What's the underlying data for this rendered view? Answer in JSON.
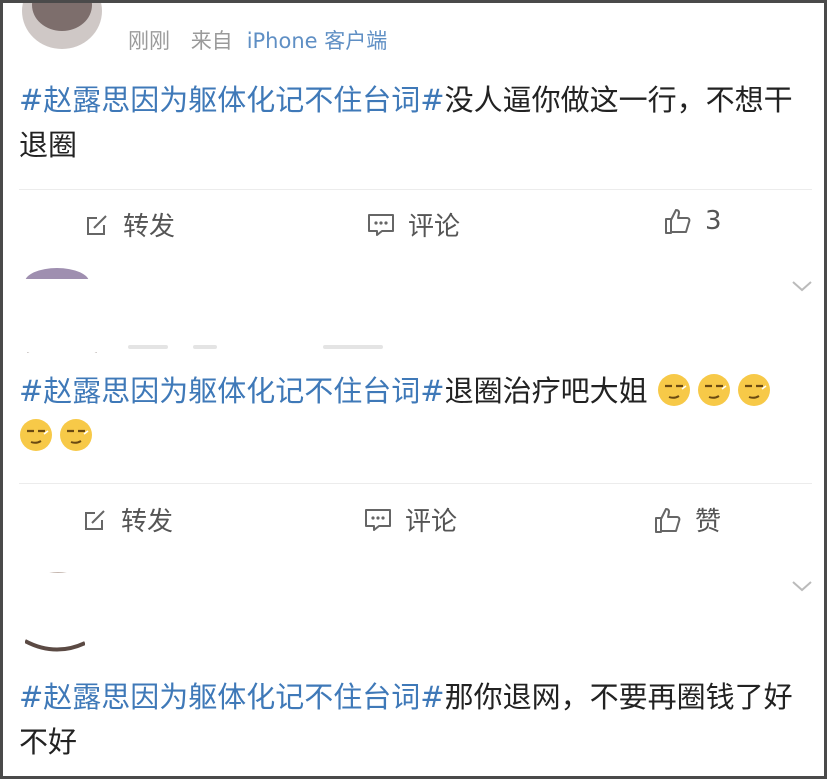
{
  "posts": [
    {
      "meta": {
        "time": "刚刚",
        "source_prefix": "来自",
        "source": "iPhone 客户端"
      },
      "content": {
        "topic": "#赵露思因为躯体化记不住台词#",
        "text": "没人逼你做这一行，不想干退圈"
      },
      "actions": {
        "repost": "转发",
        "comment": "评论",
        "like": "3"
      }
    },
    {
      "content": {
        "topic": "#赵露思因为躯体化记不住台词#",
        "text": "退圈治疗吧大姐"
      },
      "emojis": [
        "smirk-emoji",
        "smirk-emoji",
        "smirk-emoji",
        "smirk-emoji",
        "smirk-emoji"
      ],
      "actions": {
        "repost": "转发",
        "comment": "评论",
        "like": "赞"
      }
    },
    {
      "content": {
        "topic": "#赵露思因为躯体化记不住台词#",
        "text": "那你退网，不要再圈钱了好不好"
      }
    }
  ],
  "colors": {
    "topic": "#3f79b8",
    "meta_source": "#5f8fc4",
    "text": "#222222",
    "muted": "#9a9a9a"
  },
  "icons": {
    "repost": "edit-square-icon",
    "comment": "chat-bubble-icon",
    "like": "thumbs-up-icon",
    "expand": "chevron-down-icon"
  }
}
